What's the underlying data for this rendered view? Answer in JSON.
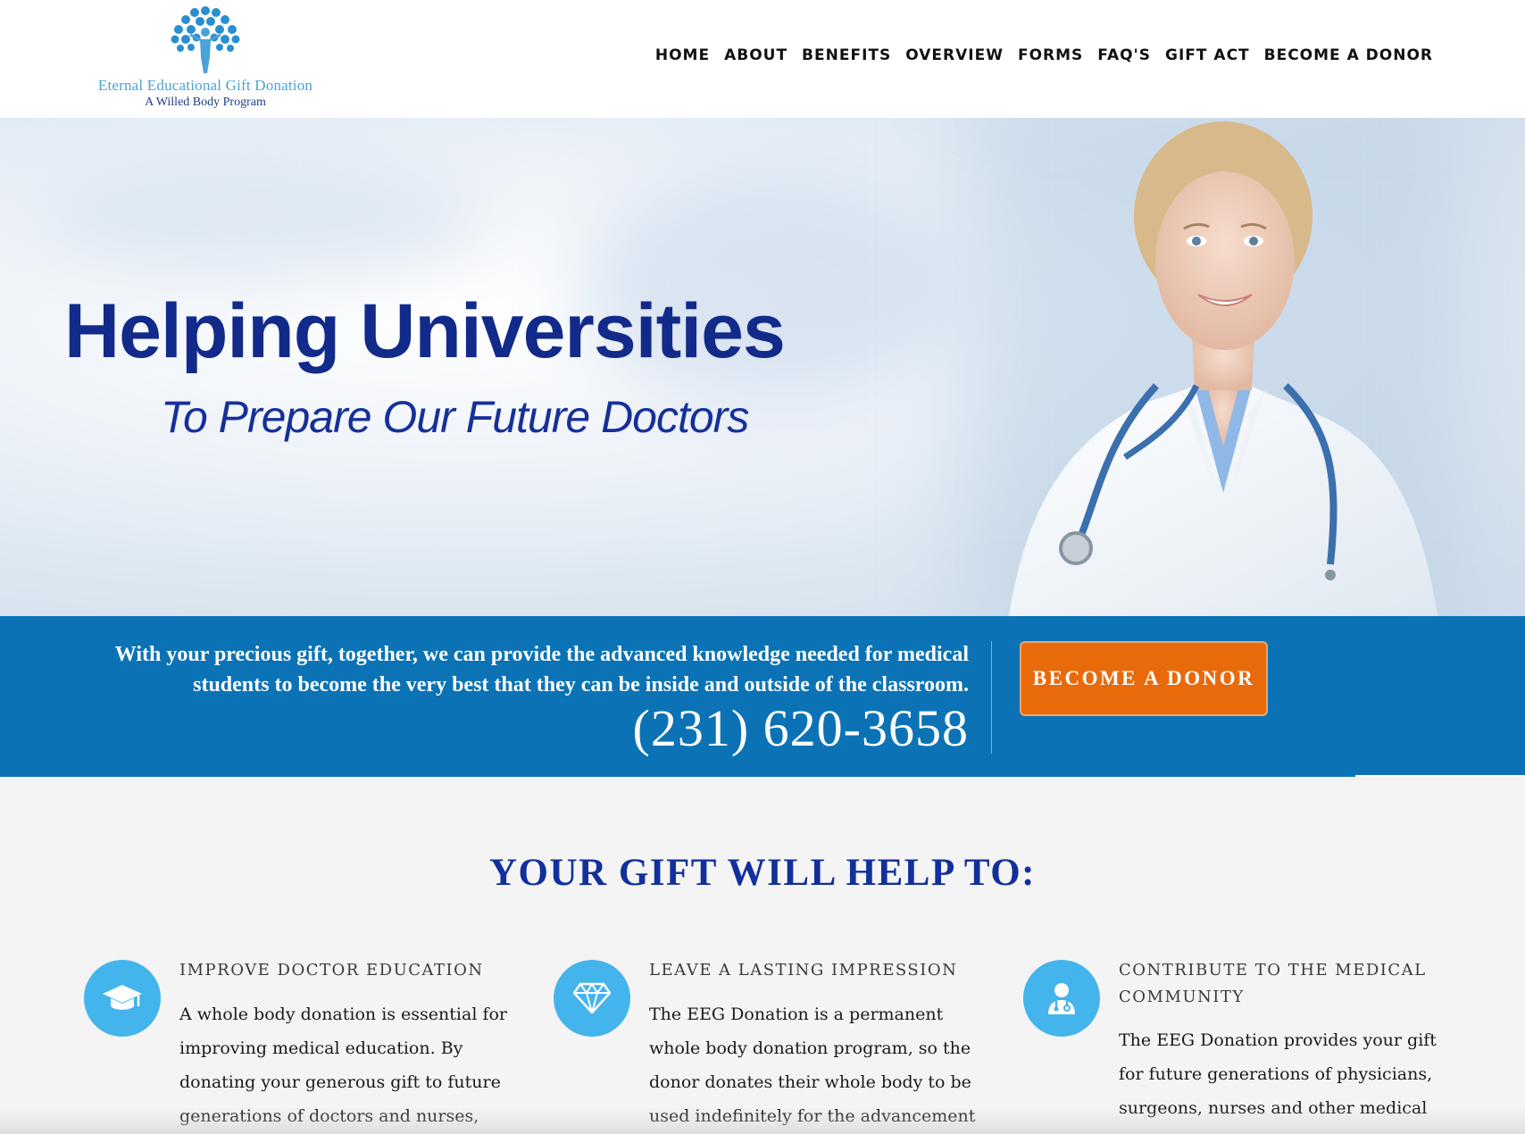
{
  "header": {
    "logo_name": "Eternal Educational Gift Donation",
    "logo_tagline": "A Willed Body Program",
    "nav": [
      "HOME",
      "ABOUT",
      "BENEFITS",
      "OVERVIEW",
      "FORMS",
      "FAQ'S",
      "GIFT ACT",
      "BECOME A DONOR"
    ]
  },
  "hero": {
    "title": "Helping Universities",
    "subtitle": "To Prepare Our Future Doctors"
  },
  "band": {
    "text": "With your precious gift, together, we can provide the advanced knowledge needed for medical students to become the very best that they can be inside and outside of the classroom.",
    "phone": "(231) 620-3658",
    "button_label": "BECOME A DONOR"
  },
  "section": {
    "title": "YOUR GIFT WILL HELP TO:",
    "features": [
      {
        "icon": "graduation-cap-icon",
        "title": "IMPROVE DOCTOR EDUCATION",
        "body": "A whole body donation is essential for improving medical education. By donating your generous gift to future generations of doctors and nurses,"
      },
      {
        "icon": "diamond-icon",
        "title": "LEAVE A LASTING IMPRESSION",
        "body": "The EEG Donation is a permanent whole body donation program, so the donor donates their whole body to be used indefinitely for the advancement of"
      },
      {
        "icon": "doctor-icon",
        "title": "CONTRIBUTE TO THE MEDICAL COMMUNITY",
        "body": "The EEG Donation provides your gift for future generations of physicians, surgeons, nurses and other medical"
      }
    ]
  },
  "colors": {
    "brand_blue": "#0b73b5",
    "heading_blue": "#12309b",
    "accent_orange": "#e96a0b",
    "icon_blue": "#44b4ec"
  }
}
